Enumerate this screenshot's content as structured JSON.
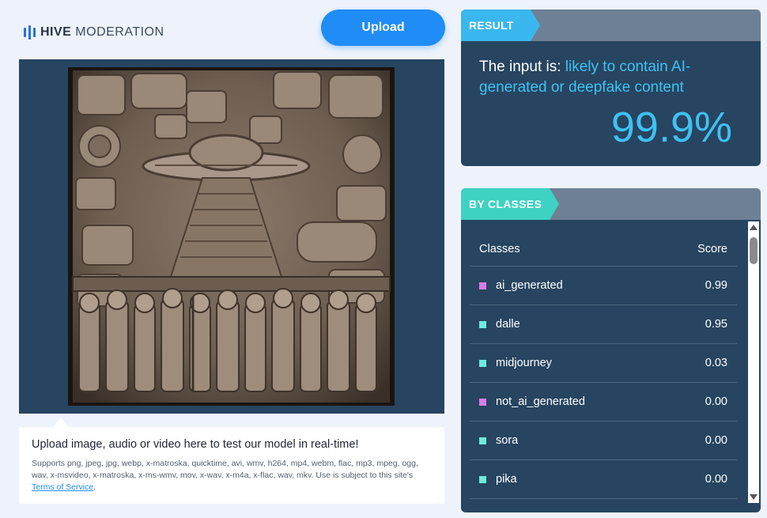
{
  "header": {
    "logo_bold": "HIVE",
    "logo_light": "MODERATION",
    "upload_label": "Upload"
  },
  "upload_info": {
    "title": "Upload image, audio or video here to test our model in real-time!",
    "supports": "Supports png, jpeg, jpg, webp, x-matroska, quicktime, avi, wmv, h264, mp4, webm, flac, mp3, mpeg, ogg, wav, x-msvideo, x-matroska, x-ms-wmv, mov, x-wav, x-m4a, x-flac, wav, mkv. Use is subject to this site's ",
    "tos_link": "Terms of Service",
    "tos_suffix": "."
  },
  "result": {
    "tag": "RESULT",
    "prefix": "The input is: ",
    "verdict": "likely to contain AI-generated or deepfake content",
    "score": "99.9%",
    "verdict_color": "#3fc1f3"
  },
  "classes": {
    "tag": "BY CLASSES",
    "col_class": "Classes",
    "col_score": "Score",
    "rows": [
      {
        "name": "ai_generated",
        "score": "0.99",
        "color": "#d97ce8"
      },
      {
        "name": "dalle",
        "score": "0.95",
        "color": "#6fe8e0"
      },
      {
        "name": "midjourney",
        "score": "0.03",
        "color": "#6fe8e0"
      },
      {
        "name": "not_ai_generated",
        "score": "0.00",
        "color": "#d97ce8"
      },
      {
        "name": "sora",
        "score": "0.00",
        "color": "#6fe8e0"
      },
      {
        "name": "pika",
        "score": "0.00",
        "color": "#6fe8e0"
      }
    ]
  },
  "colors": {
    "accent_blue": "#1f8df5",
    "panel_navy": "#274560",
    "result_tag": "#39b7ee",
    "classes_tag": "#3ed2c2"
  }
}
